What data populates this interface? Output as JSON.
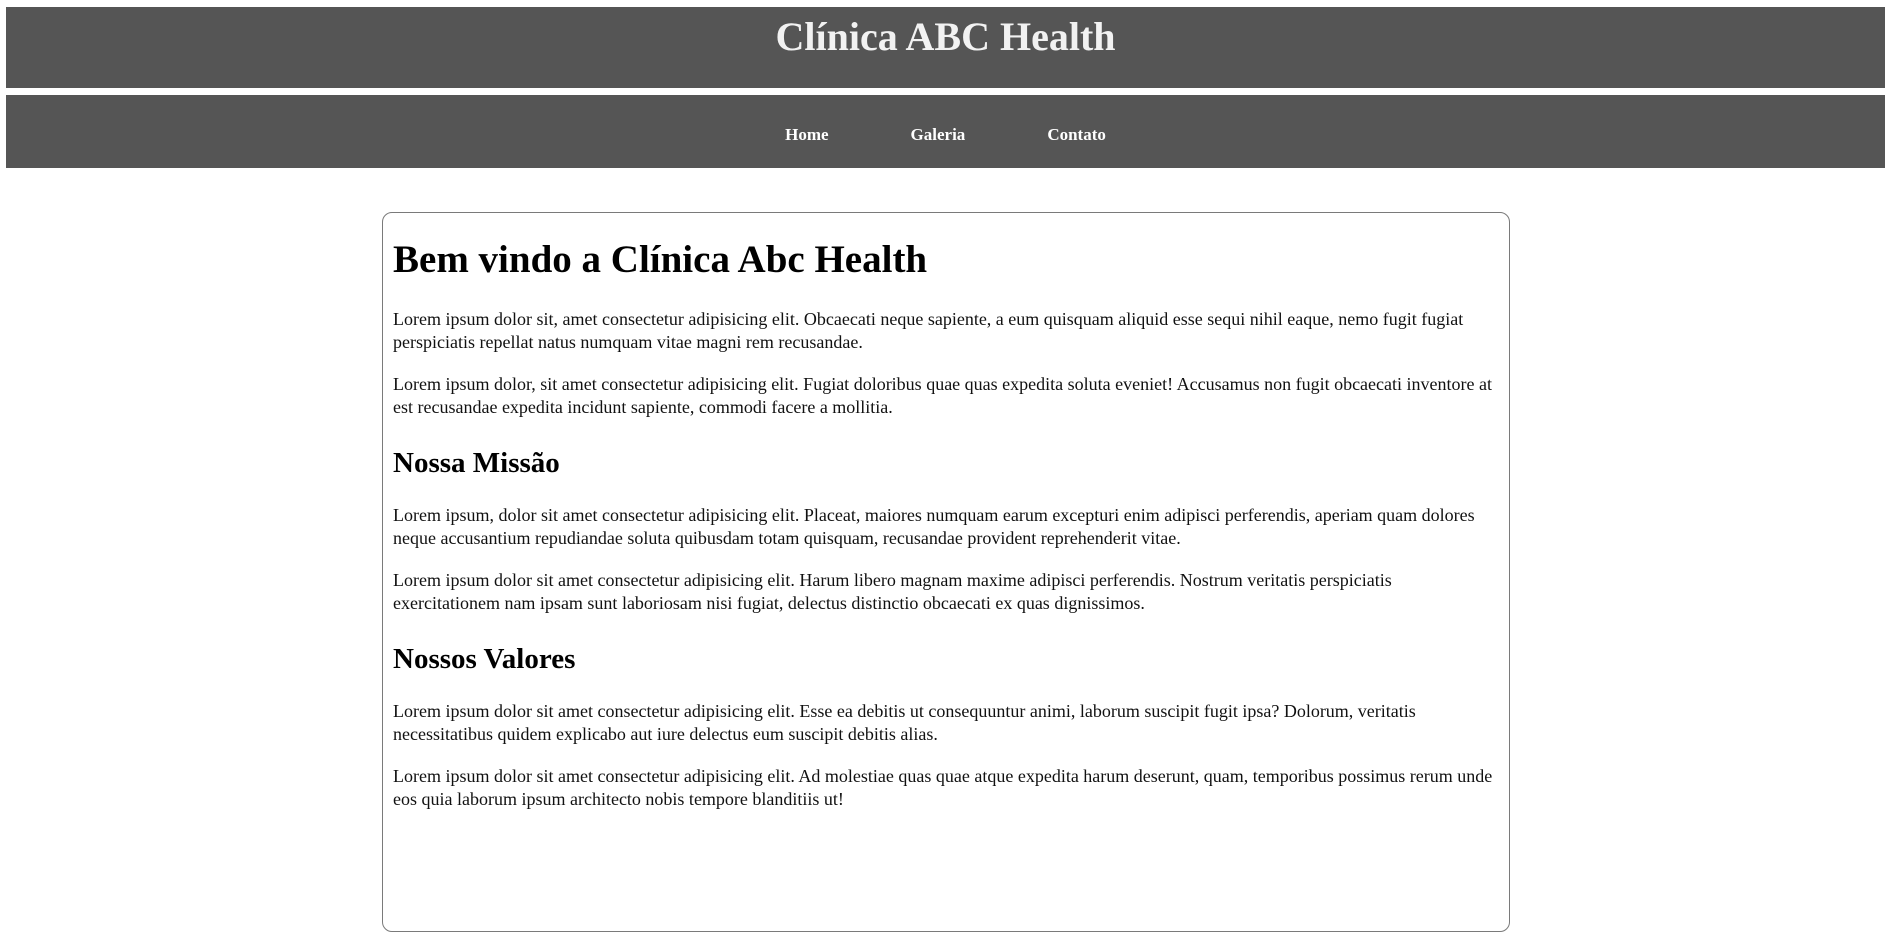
{
  "header": {
    "title": "Clínica ABC Health"
  },
  "nav": {
    "items": [
      {
        "label": "Home"
      },
      {
        "label": "Galeria"
      },
      {
        "label": "Contato"
      }
    ]
  },
  "main": {
    "welcome_title": "Bem vindo a Clínica Abc Health",
    "intro_paragraphs": [
      "Lorem ipsum dolor sit, amet consectetur adipisicing elit. Obcaecati neque sapiente, a eum quisquam aliquid esse sequi nihil eaque, nemo fugit fugiat perspiciatis repellat natus numquam vitae magni rem recusandae.",
      "Lorem ipsum dolor, sit amet consectetur adipisicing elit. Fugiat doloribus quae quas expedita soluta eveniet! Accusamus non fugit obcaecati inventore at est recusandae expedita incidunt sapiente, commodi facere a mollitia."
    ],
    "mission": {
      "title": "Nossa Missão",
      "paragraphs": [
        "Lorem ipsum, dolor sit amet consectetur adipisicing elit. Placeat, maiores numquam earum excepturi enim adipisci perferendis, aperiam quam dolores neque accusantium repudiandae soluta quibusdam totam quisquam, recusandae provident reprehenderit vitae.",
        "Lorem ipsum dolor sit amet consectetur adipisicing elit. Harum libero magnam maxime adipisci perferendis. Nostrum veritatis perspiciatis exercitationem nam ipsam sunt laboriosam nisi fugiat, delectus distinctio obcaecati ex quas dignissimos."
      ]
    },
    "values": {
      "title": "Nossos Valores",
      "paragraphs": [
        "Lorem ipsum dolor sit amet consectetur adipisicing elit. Esse ea debitis ut consequuntur animi, laborum suscipit fugit ipsa? Dolorum, veritatis necessitatibus quidem explicabo aut iure delectus eum suscipit debitis alias.",
        "Lorem ipsum dolor sit amet consectetur adipisicing elit. Ad molestiae quas quae atque expedita harum deserunt, quam, temporibus possimus rerum unde eos quia laborum ipsum architecto nobis tempore blanditiis ut!"
      ]
    }
  },
  "colors": {
    "header_bg": "#555555",
    "header_text": "#f2f2f2",
    "nav_text": "#ffffff",
    "card_border": "#7a7a7a"
  }
}
